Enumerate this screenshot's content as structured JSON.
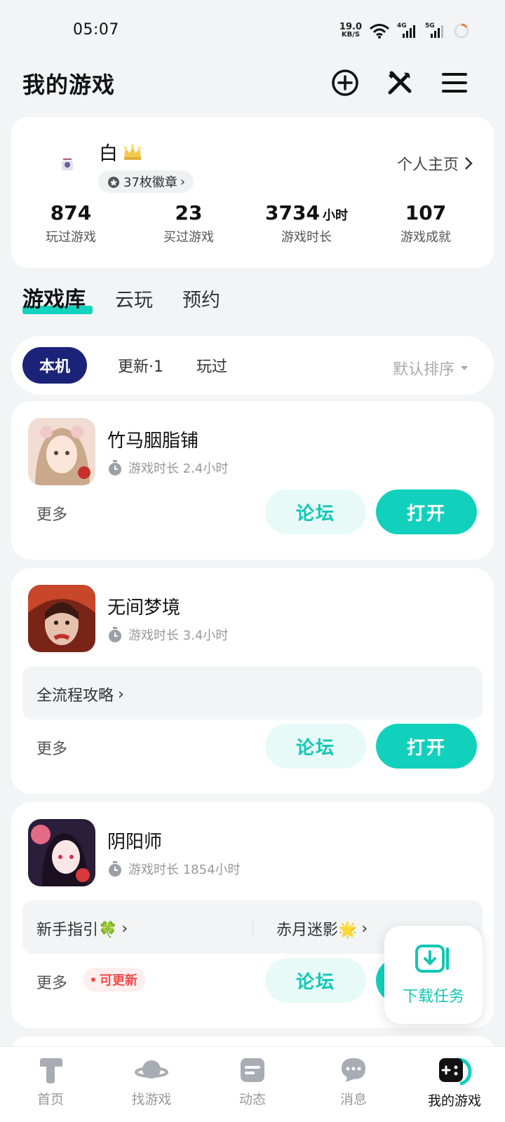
{
  "status_bar": {
    "time": "05:07",
    "net_speed_value": "19.0",
    "net_speed_unit": "KB/S",
    "sim1": "4G",
    "sim2": "5G"
  },
  "header": {
    "title": "我的游戏",
    "icons": [
      "add-circle-icon",
      "tools-icon",
      "menu-icon"
    ]
  },
  "profile": {
    "name": "白",
    "badges_label": "37枚徽章",
    "homepage_label": "个人主页",
    "stats": [
      {
        "value": "874",
        "unit": "",
        "label": "玩过游戏"
      },
      {
        "value": "23",
        "unit": "",
        "label": "买过游戏"
      },
      {
        "value": "3734",
        "unit": "小时",
        "label": "游戏时长"
      },
      {
        "value": "107",
        "unit": "",
        "label": "游戏成就"
      }
    ]
  },
  "library_tabs": [
    {
      "label": "游戏库",
      "active": true
    },
    {
      "label": "云玩",
      "active": false
    },
    {
      "label": "预约",
      "active": false
    }
  ],
  "filters": {
    "chips": [
      {
        "label": "本机",
        "active": true
      },
      {
        "label": "更新·1",
        "active": false
      },
      {
        "label": "玩过",
        "active": false
      }
    ],
    "sort_label": "默认排序"
  },
  "games": [
    {
      "name": "竹马胭脂铺",
      "playtime": "游戏时长 2.4小时",
      "more_label": "更多",
      "forum_label": "论坛",
      "open_label": "打开"
    },
    {
      "name": "无间梦境",
      "playtime": "游戏时长 3.4小时",
      "guides": [
        "全流程攻略"
      ],
      "more_label": "更多",
      "forum_label": "论坛",
      "open_label": "打开"
    },
    {
      "name": "阴阳师",
      "playtime": "游戏时长 1854小时",
      "guides": [
        "新手指引🍀",
        "赤月迷影🌟"
      ],
      "more_label": "更多",
      "update_label": "可更新",
      "forum_label": "论坛",
      "open_label": "打开"
    }
  ],
  "download_task": {
    "label": "下载任务"
  },
  "bottom_nav": [
    {
      "label": "首页",
      "icon": "home-icon",
      "active": false
    },
    {
      "label": "找游戏",
      "icon": "planet-icon",
      "active": false
    },
    {
      "label": "动态",
      "icon": "feed-icon",
      "active": false
    },
    {
      "label": "消息",
      "icon": "chat-icon",
      "active": false
    },
    {
      "label": "我的游戏",
      "icon": "gamepad-icon",
      "active": true
    }
  ],
  "colors": {
    "accent": "#12d1bc",
    "chip_active": "#1b2379",
    "update_red": "#f04a4a"
  }
}
